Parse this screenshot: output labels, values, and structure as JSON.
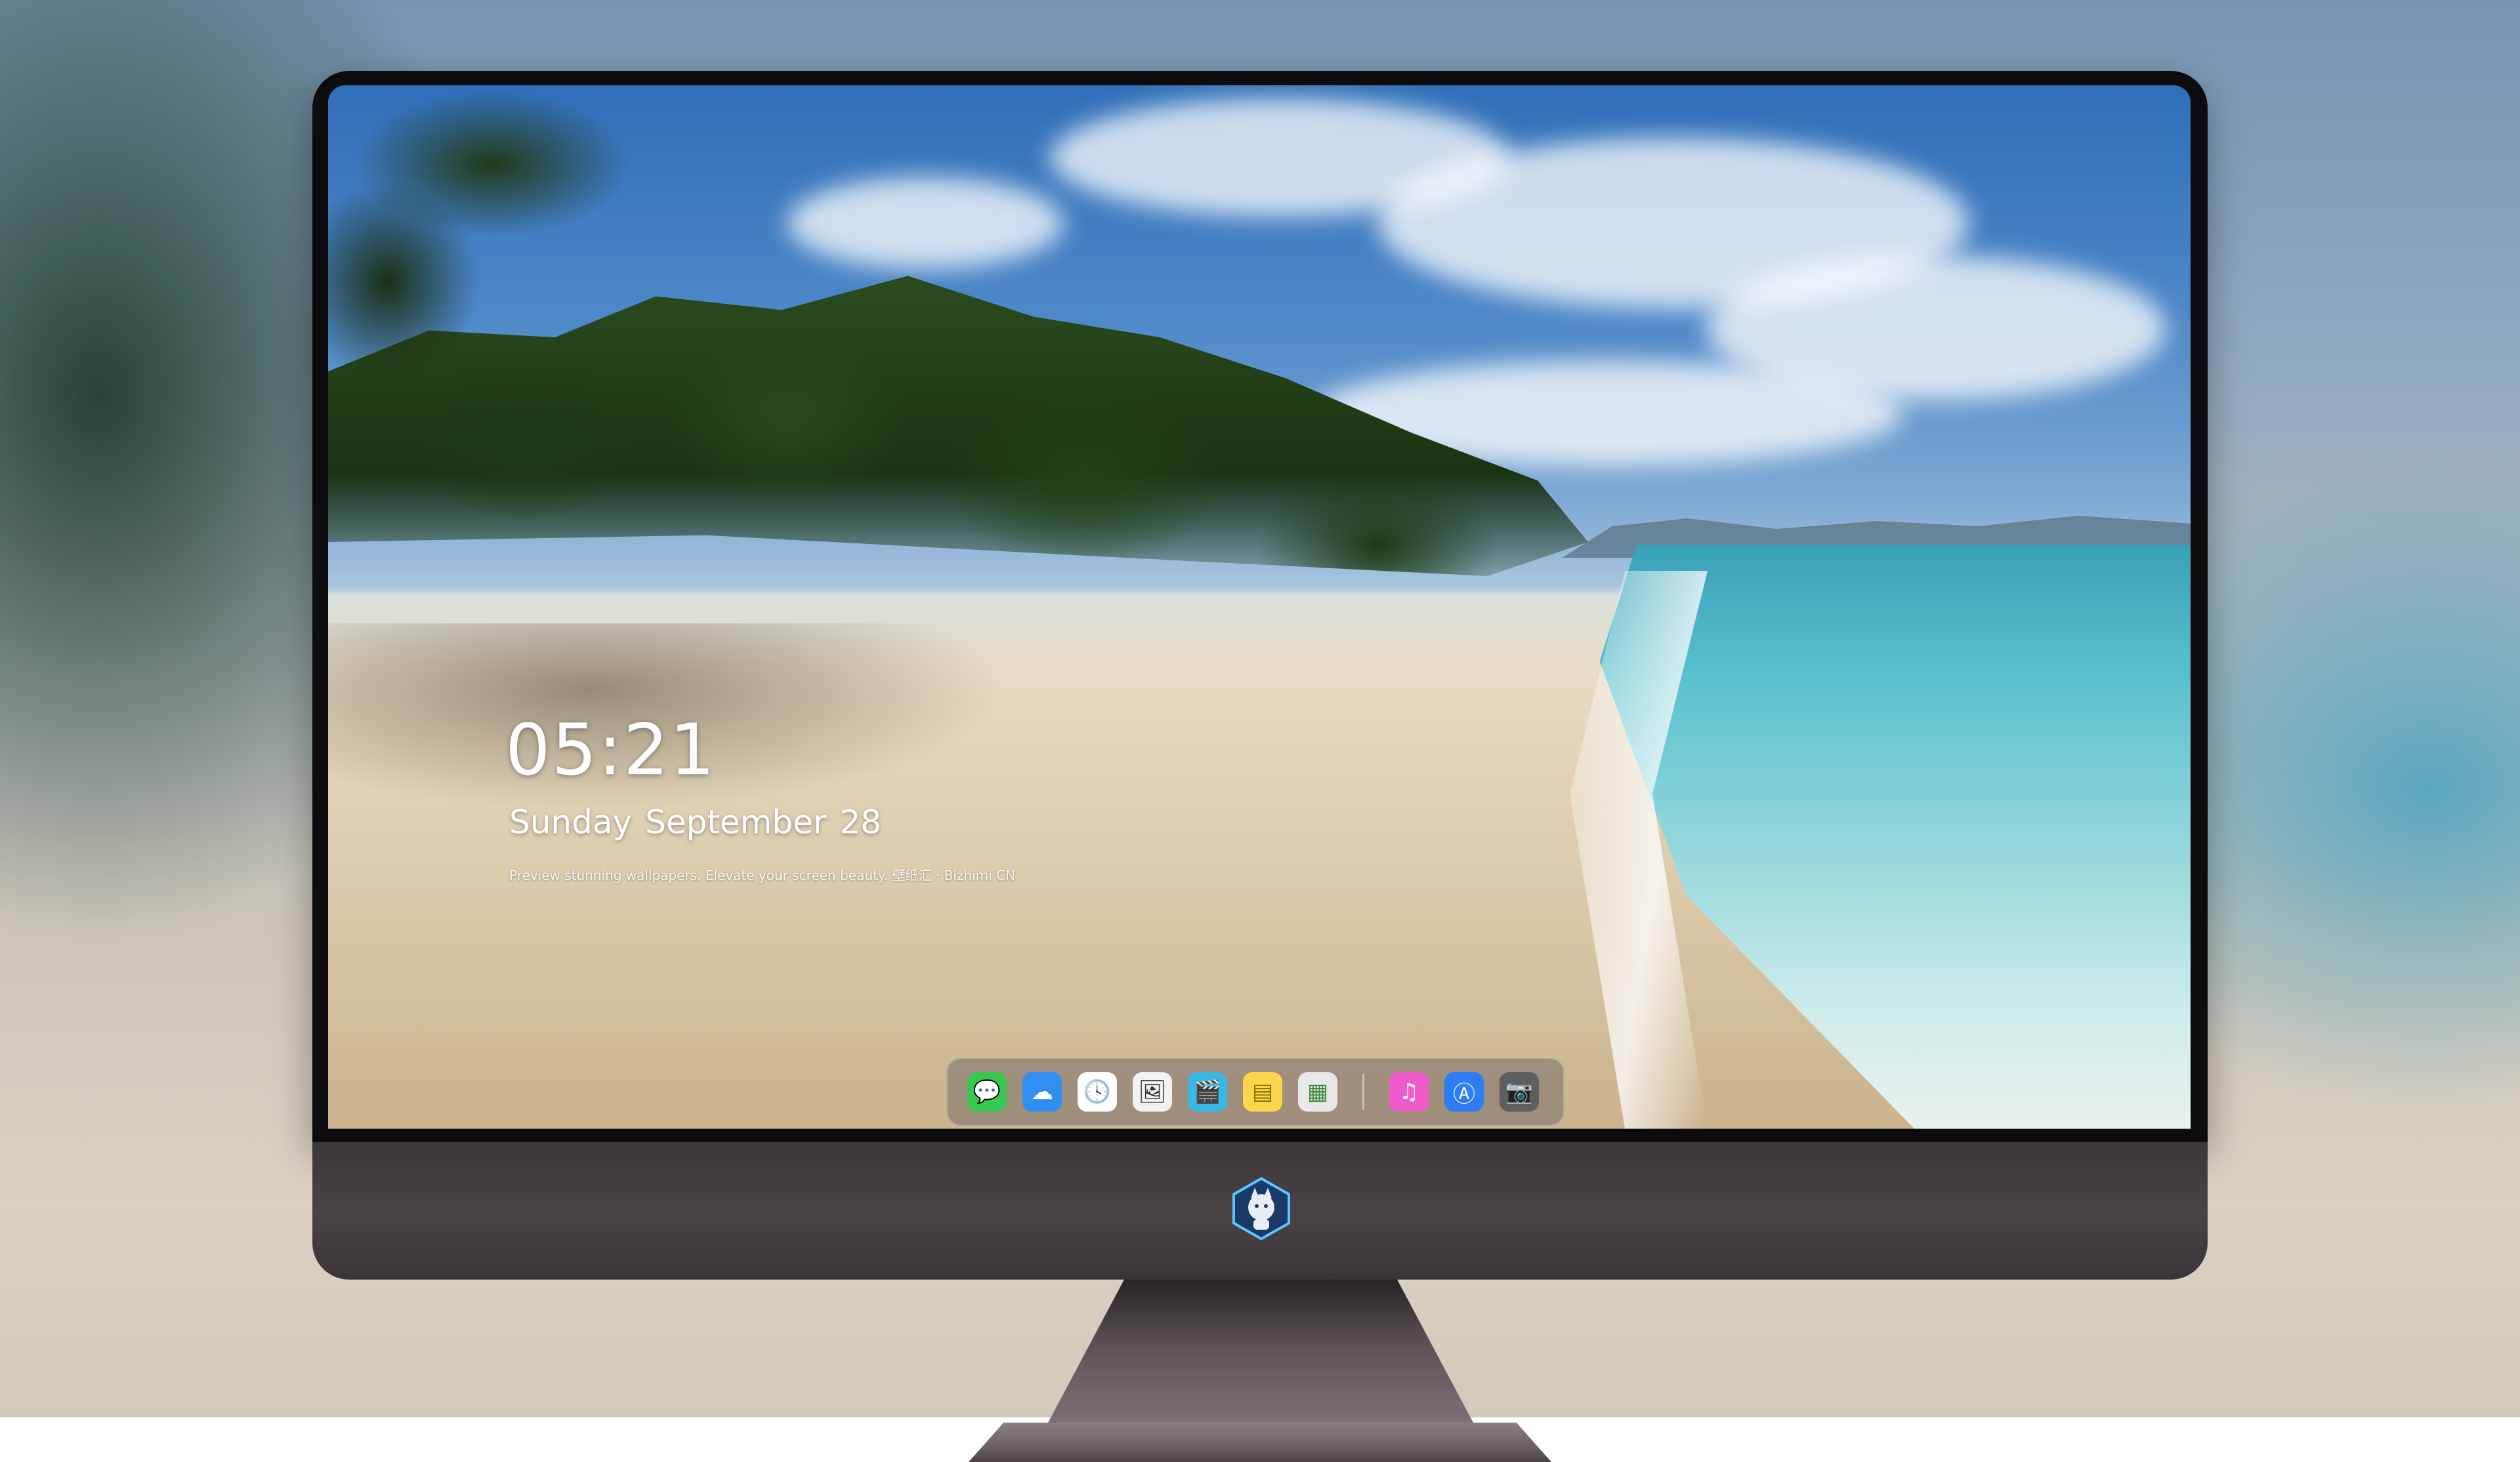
{
  "lockscreen": {
    "time": "05:21",
    "weekday": "Sunday",
    "month": "September",
    "day": "28",
    "caption": "Preview stunning wallpapers. Elevate your screen beauty. 壁纸汇 · Bizhimi CN"
  },
  "dock": {
    "apps": [
      {
        "name": "messages-icon",
        "glyph": "💬",
        "bg": "#38c84f"
      },
      {
        "name": "weather-icon",
        "glyph": "☁",
        "bg": "#2f8ff0"
      },
      {
        "name": "clock-icon",
        "glyph": "🕓",
        "bg": "#ffffff"
      },
      {
        "name": "preview-icon",
        "glyph": "🖼",
        "bg": "#f2f2f2"
      },
      {
        "name": "clips-icon",
        "glyph": "🎬",
        "bg": "#39b8e6"
      },
      {
        "name": "notes-icon",
        "glyph": "▤",
        "bg": "#fbd64a"
      },
      {
        "name": "photo-booth-icon",
        "glyph": "▦",
        "bg": "#e8e8e8"
      },
      {
        "name": "music-icon",
        "glyph": "♫",
        "bg": "#f05acb"
      },
      {
        "name": "app-store-icon",
        "glyph": "Ⓐ",
        "bg": "#2d7ef5"
      },
      {
        "name": "camera-icon",
        "glyph": "📷",
        "bg": "#5f5f62"
      }
    ]
  },
  "colors": {
    "sky": "#4d88c8",
    "sand": "#dccbad",
    "sea": "#5ec3cf",
    "bezel": "#0c0c0e",
    "chin": "#4a4448"
  }
}
